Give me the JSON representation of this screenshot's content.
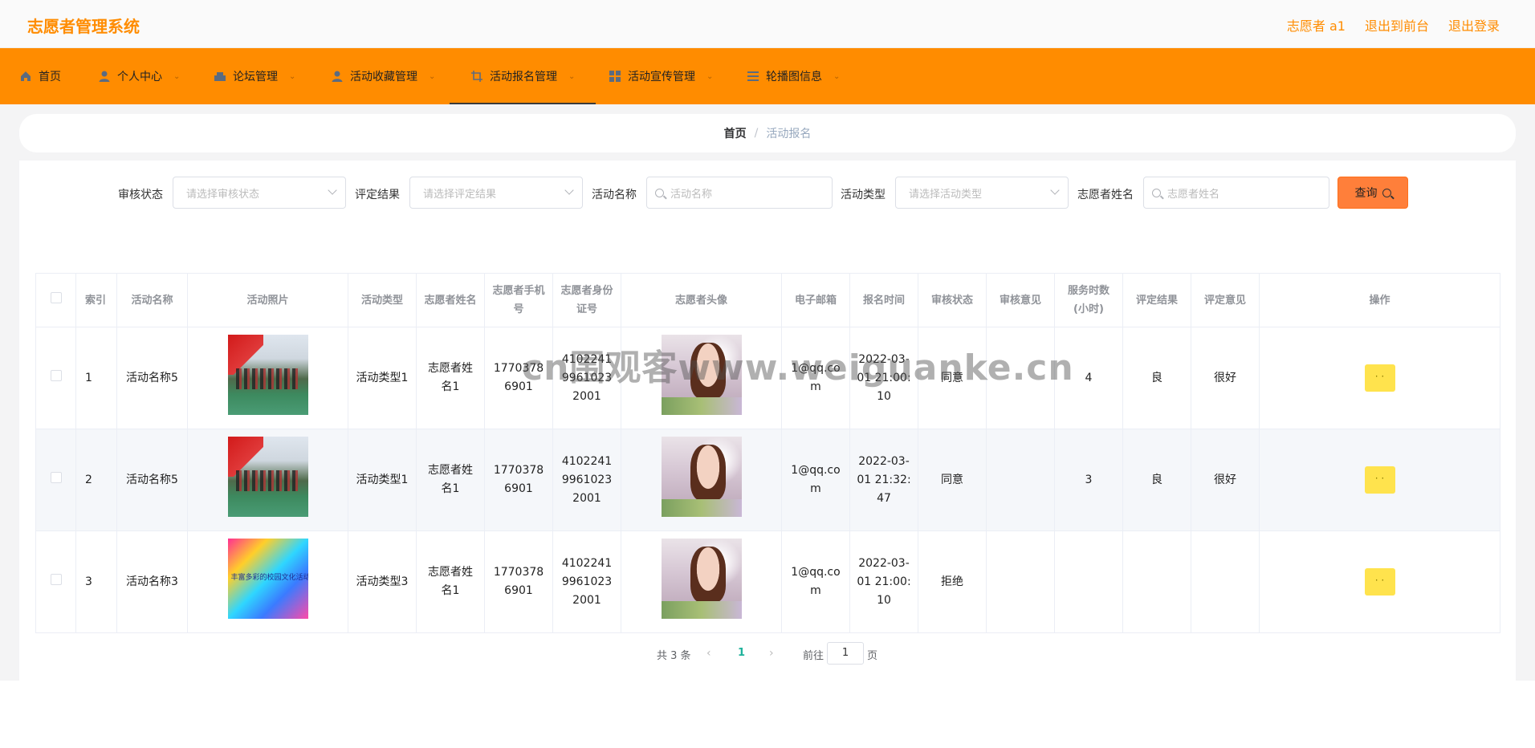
{
  "header": {
    "app_title": "志愿者管理系统",
    "user_label": "志愿者 a1",
    "to_frontend": "退出到前台",
    "logout": "退出登录"
  },
  "nav": {
    "items": [
      {
        "label": "首页",
        "icon": "home-icon",
        "has_dropdown": false
      },
      {
        "label": "个人中心",
        "icon": "user-icon",
        "has_dropdown": true
      },
      {
        "label": "论坛管理",
        "icon": "forum-icon",
        "has_dropdown": true
      },
      {
        "label": "活动收藏管理",
        "icon": "person-icon",
        "has_dropdown": true
      },
      {
        "label": "活动报名管理",
        "icon": "crop-icon",
        "has_dropdown": true,
        "active": true
      },
      {
        "label": "活动宣传管理",
        "icon": "grid-icon",
        "has_dropdown": true
      },
      {
        "label": "轮播图信息",
        "icon": "list-icon",
        "has_dropdown": true
      }
    ]
  },
  "breadcrumb": {
    "home": "首页",
    "separator": "/",
    "current": "活动报名"
  },
  "search": {
    "audit_status": {
      "label": "审核状态",
      "placeholder": "请选择审核状态"
    },
    "evaluation_result": {
      "label": "评定结果",
      "placeholder": "请选择评定结果"
    },
    "activity_name": {
      "label": "活动名称",
      "placeholder": "活动名称"
    },
    "activity_type": {
      "label": "活动类型",
      "placeholder": "请选择活动类型"
    },
    "volunteer_name": {
      "label": "志愿者姓名",
      "placeholder": "志愿者姓名"
    },
    "button": "查询"
  },
  "table": {
    "columns": [
      "索引",
      "活动名称",
      "活动照片",
      "活动类型",
      "志愿者姓名",
      "志愿者手机号",
      "志愿者身份证号",
      "志愿者头像",
      "电子邮箱",
      "报名时间",
      "审核状态",
      "审核意见",
      "服务时数(小时)",
      "评定结果",
      "评定意见",
      "操作"
    ],
    "rows": [
      {
        "index": "1",
        "activity_name": "活动名称5",
        "photo": "event-photo",
        "activity_type": "活动类型1",
        "volunteer_name": "志愿者姓名1",
        "phone": "17703786901",
        "id_number": "410224199610232001",
        "email": "1@qq.com",
        "signup_time": "2022-03-01 21:00:10",
        "audit_status": "同意",
        "audit_opinion": "",
        "service_hours": "4",
        "evaluation_result": "良",
        "evaluation_opinion": "很好",
        "op": "· ·"
      },
      {
        "index": "2",
        "activity_name": "活动名称5",
        "photo": "event-photo",
        "activity_type": "活动类型1",
        "volunteer_name": "志愿者姓名1",
        "phone": "17703786901",
        "id_number": "410224199610232001",
        "email": "1@qq.com",
        "signup_time": "2022-03-01 21:32:47",
        "audit_status": "同意",
        "audit_opinion": "",
        "service_hours": "3",
        "evaluation_result": "良",
        "evaluation_opinion": "很好",
        "op": "· ·"
      },
      {
        "index": "3",
        "activity_name": "活动名称3",
        "photo": "rainbow-photo",
        "photo_caption": "丰富多彩的校园文化活动",
        "activity_type": "活动类型3",
        "volunteer_name": "志愿者姓名1",
        "phone": "17703786901",
        "id_number": "410224199610232001",
        "email": "1@qq.com",
        "signup_time": "2022-03-01 21:00:10",
        "audit_status": "拒绝",
        "audit_opinion": "",
        "service_hours": "",
        "evaluation_result": "",
        "evaluation_opinion": "",
        "op": "· ·"
      }
    ]
  },
  "pagination": {
    "total": "共 3 条",
    "prev": "‹",
    "current_page": "1",
    "next": "›",
    "goto_label": "前往",
    "goto_value": "1",
    "page_unit": "页"
  },
  "watermark": "cn围观客www.weiguanke.cn",
  "colors": {
    "accent": "#ff8c00",
    "search_button": "#ff7f3a",
    "op_button": "#ffe34d",
    "page_active": "#1fb29b"
  }
}
